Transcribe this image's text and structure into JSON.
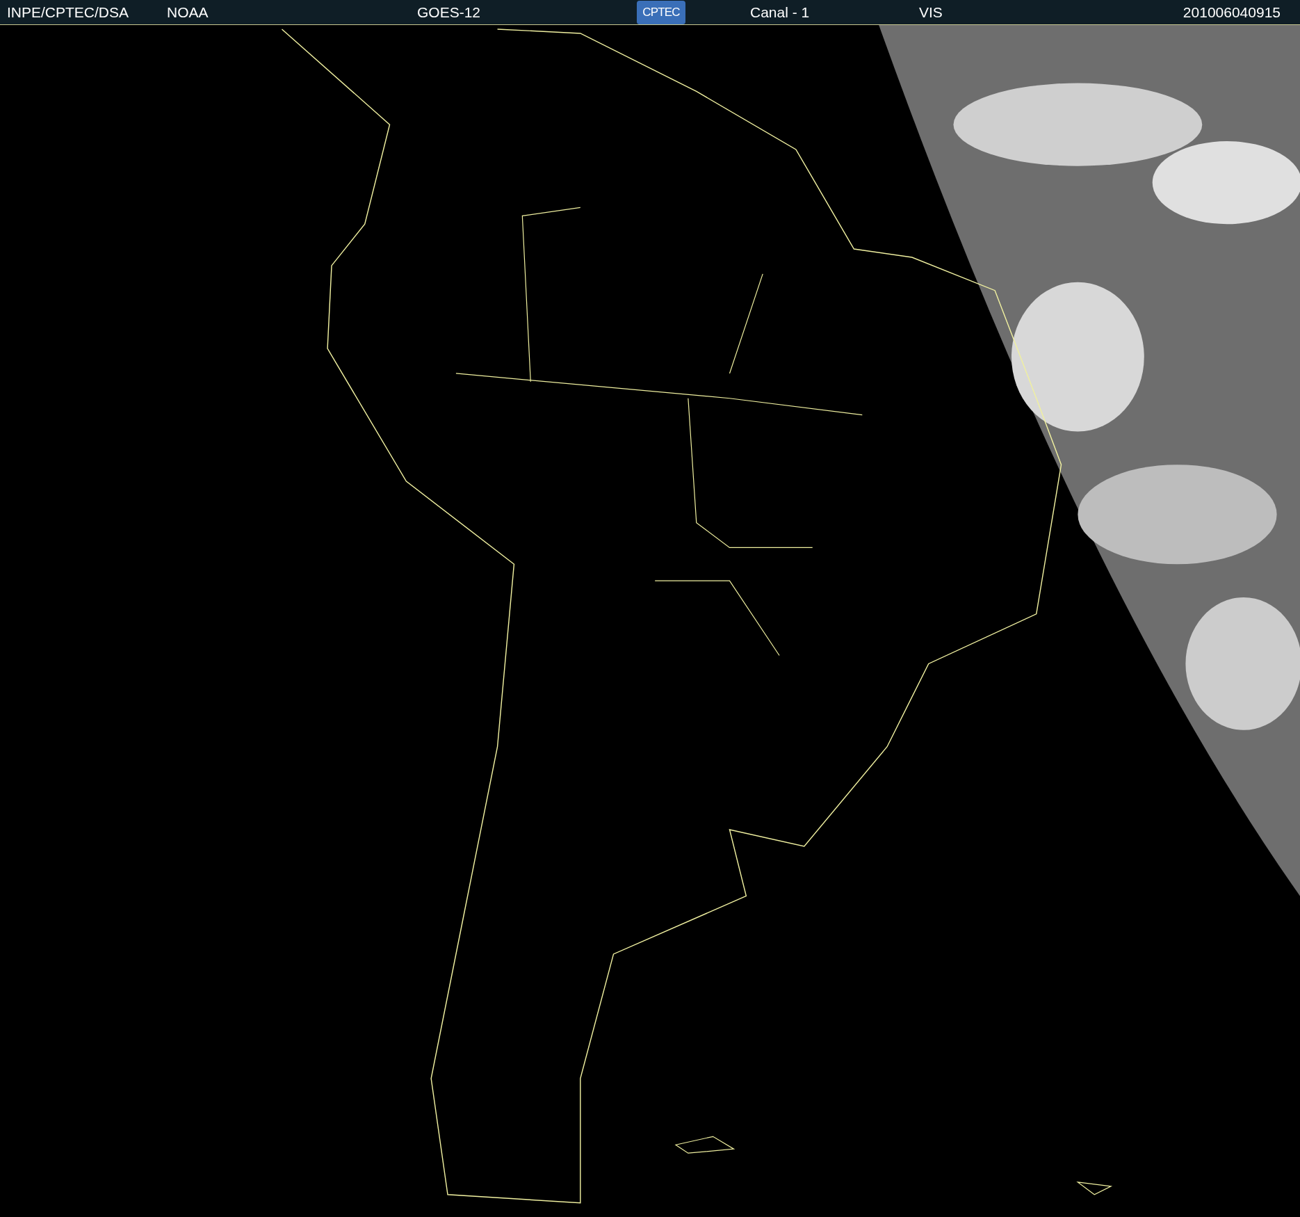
{
  "header": {
    "source": "INPE/CPTEC/DSA",
    "agency": "NOAA",
    "satellite": "GOES-12",
    "logo": "CPTEC",
    "channel": "Canal - 1",
    "band": "VIS",
    "timestamp": "201006040915"
  }
}
